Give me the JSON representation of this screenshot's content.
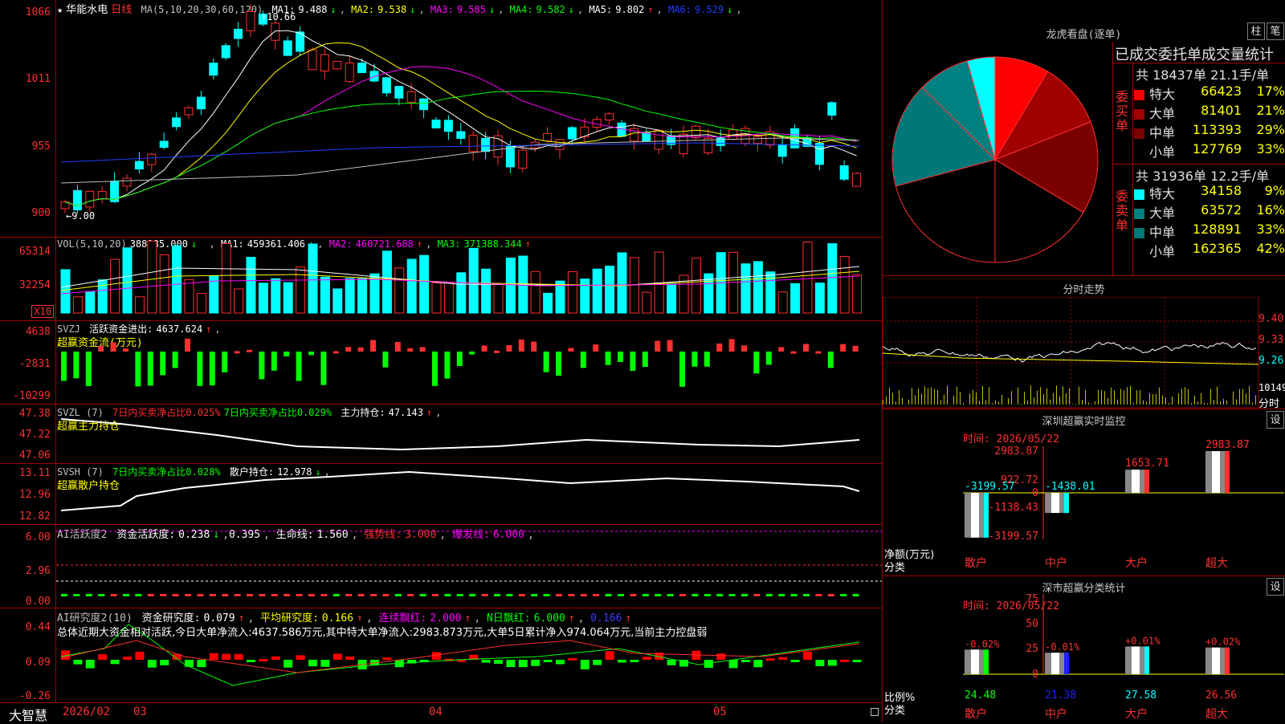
{
  "colors": {
    "up": "#ff3030",
    "down": "#00ffff",
    "ma1": "#ffffff",
    "ma2": "#ffff00",
    "ma3": "#ff00ff",
    "ma4": "#00ff00",
    "ma5": "#c0c0c0",
    "ma6": "#2040ff",
    "green": "#00ff00",
    "grid": "#a00000"
  },
  "stock": {
    "name": "华能水电",
    "period": "日线",
    "star": "★"
  },
  "kline": {
    "ma_label": "MA(5,10,20,30,60,120)",
    "ma_items": [
      {
        "label": "MA1:",
        "value": "9.488",
        "arrow": "↓"
      },
      {
        "label": "MA2:",
        "value": "9.538",
        "arrow": "↓"
      },
      {
        "label": "MA3:",
        "value": "9.585",
        "arrow": "↓"
      },
      {
        "label": "MA4:",
        "value": "9.582",
        "arrow": "↓"
      },
      {
        "label": "MA5:",
        "value": "9.802",
        "arrow": "↑"
      },
      {
        "label": "MA6:",
        "value": "9.529",
        "arrow": "↓"
      }
    ],
    "yticks": [
      "1066",
      "1011",
      "955",
      "900"
    ],
    "high_label": "10.66",
    "low_label": "9.00"
  },
  "vol": {
    "label": "VOL(5,10,20)",
    "value": "388985.000",
    "arrow": "↓",
    "items": [
      {
        "label": "MA1:",
        "value": "459361.406",
        "arrow": "↓"
      },
      {
        "label": "MA2:",
        "value": "460721.688",
        "arrow": "↑"
      },
      {
        "label": "MA3:",
        "value": "371388.344",
        "arrow": "↑"
      }
    ],
    "yticks": [
      "65314",
      "32254"
    ],
    "unit": "X10"
  },
  "svzj": {
    "label": "SVZJ",
    "name": "活跃资金进出:",
    "value": "4637.624",
    "arrow": "↑",
    "sub": "超赢资金流(万元)",
    "yticks": [
      "4638",
      "-2831",
      "-10299"
    ]
  },
  "svzl": {
    "label": "SVZL (7)",
    "red": "7日内买卖净占比0.025%",
    "green": "7日内买卖净占比0.029%",
    "name": "主力持仓:",
    "value": "47.143",
    "arrow": "↑",
    "sub": "超赢主力持仓",
    "yticks": [
      "47.38",
      "47.22",
      "47.06"
    ]
  },
  "svsh": {
    "label": "SVSH (7)",
    "green": "7日内买卖净占比0.028%",
    "name": "散户持仓:",
    "value": "12.978",
    "arrow": "↓",
    "sub": "超赢散户持仓",
    "yticks": [
      "13.11",
      "12.96",
      "12.82"
    ]
  },
  "ai1": {
    "label": "AI活跃度2",
    "name": "资金活跃度:",
    "v1": "0.238",
    "a1": "↓",
    "v2": "0.395",
    "life": "生命线:",
    "lifev": "1.560",
    "strong": "强势线:",
    "strongv": "3.000",
    "burst": "爆发线:",
    "burstv": "6.000",
    "yticks": [
      "6.00",
      "2.96",
      "0.00"
    ]
  },
  "ai2": {
    "label": "AI研究度2(10)",
    "name": "资金研究度:",
    "v1": "0.079",
    "a1": "↑",
    "avg": "平均研究度:",
    "avgv": "0.166",
    "a2": "↑",
    "lian": "连续飘红:",
    "lianv": "2.000",
    "a3": "↑",
    "nri": "N日飘红:",
    "nriv": "6.000",
    "a4": "↑",
    "last": "0.166",
    "a5": "↑",
    "summary": "总体近期大资金相对活跃,今日大单净流入:4637.586万元,其中特大单净流入:2983.873万元,大单5日累计净入974.064万元,当前主力控盘弱",
    "yticks": [
      "0.44",
      "0.09",
      "-0.26"
    ]
  },
  "xaxis": {
    "brand": "大智慧",
    "labels": [
      "2026/02",
      "03",
      "04",
      "05"
    ]
  },
  "dragon": {
    "title": "龙虎看盘(逐单)",
    "btn1": "柱",
    "btn2": "笔",
    "header": "已成交委托单成交量统计",
    "buy": {
      "side": "委买单",
      "total": "共 18437单 21.1手/单",
      "rows": [
        {
          "label": "特大",
          "value": "66423",
          "pct": "17%",
          "color": "#ff0000"
        },
        {
          "label": "大单",
          "value": "81401",
          "pct": "21%",
          "color": "#a00000"
        },
        {
          "label": "中单",
          "value": "113393",
          "pct": "29%",
          "color": "#7a0000"
        },
        {
          "label": "小单",
          "value": "127769",
          "pct": "33%",
          "color": "#000000"
        }
      ]
    },
    "sell": {
      "side": "委卖单",
      "total": "共 31936单 12.2手/单",
      "rows": [
        {
          "label": "特大",
          "value": "34158",
          "pct": "9%",
          "color": "#00ffff"
        },
        {
          "label": "大单",
          "value": "63572",
          "pct": "16%",
          "color": "#008080"
        },
        {
          "label": "中单",
          "value": "128891",
          "pct": "33%",
          "color": "#007878"
        },
        {
          "label": "小单",
          "value": "162365",
          "pct": "42%",
          "color": "#000000"
        }
      ]
    }
  },
  "fenshi": {
    "title": "分时走势",
    "yticks": [
      "9.40",
      "9.33",
      "9.26"
    ],
    "vol": "10149",
    "label": "分时"
  },
  "monitor": {
    "title": "深圳超赢实时监控",
    "btn": "设",
    "time": "时间: 2026/05/22",
    "yticks": [
      "2983.87",
      "922.72",
      "0",
      "-1138.43",
      "-3199.57"
    ],
    "ylabel": "净额(万元)",
    "xlabel": "分类",
    "cats": [
      "散户",
      "中户",
      "大户",
      "超大"
    ],
    "values": [
      -3199.57,
      -1438.01,
      1653.71,
      2983.87
    ],
    "value_labels": [
      "-3199.57",
      "-1438.01",
      "1653.71",
      "2983.87"
    ]
  },
  "stats": {
    "title": "深市超赢分类统计",
    "btn": "设",
    "time": "时间: 2026/05/22",
    "yticks": [
      "75",
      "50",
      "25",
      "0"
    ],
    "ylabel": "比例%",
    "xlabel": "分类",
    "cats": [
      "散户",
      "中户",
      "大户",
      "超大"
    ],
    "values": [
      24.48,
      21.38,
      27.58,
      26.56
    ],
    "value_labels": [
      "24.48",
      "21.38",
      "27.58",
      "26.56"
    ],
    "changes": [
      "-0.02%",
      "-0.01%",
      "+0.01%",
      "+0.02%"
    ]
  }
}
